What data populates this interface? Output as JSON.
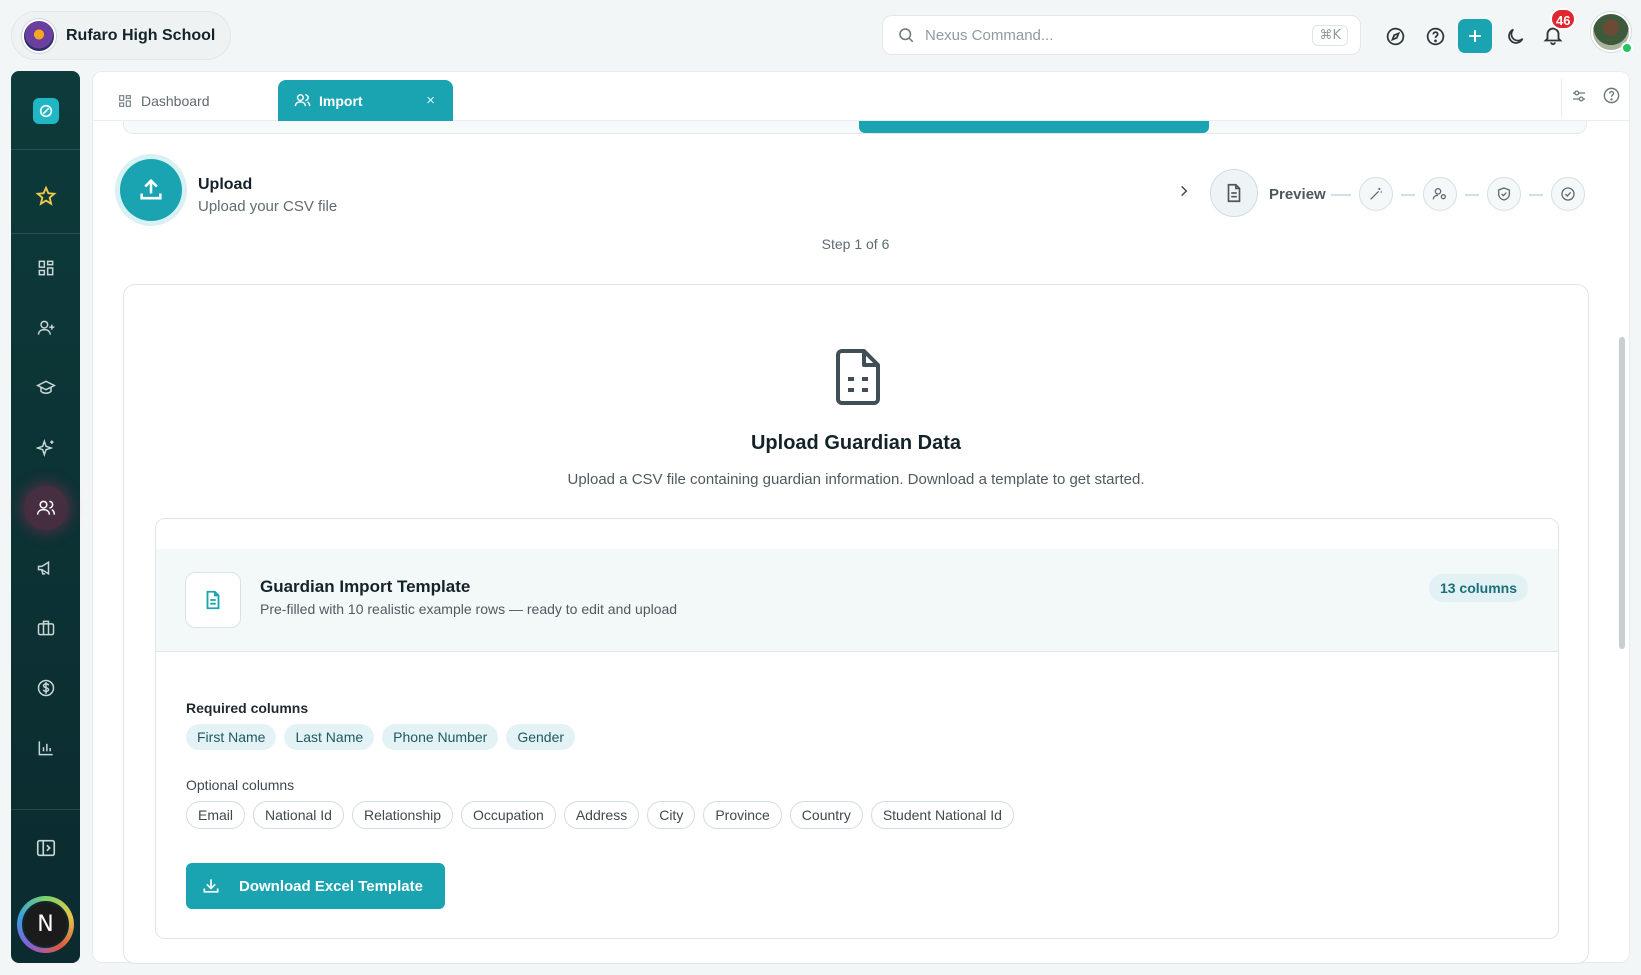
{
  "header": {
    "school_name": "Rufaro High School",
    "search_placeholder": "Nexus Command...",
    "search_shortcut": "⌘K",
    "notification_count": "46",
    "icons": [
      "compass-icon",
      "help-icon",
      "plus-icon",
      "moon-icon",
      "bell-icon"
    ]
  },
  "sidebar": {
    "items": [
      "favorites",
      "dashboard",
      "add-user",
      "academics",
      "ai-sparkles",
      "people",
      "announcements",
      "briefcase",
      "finance",
      "reports"
    ],
    "active": "people",
    "user_initial": "N"
  },
  "tabs": [
    {
      "label": "Dashboard",
      "active": false
    },
    {
      "label": "Import",
      "active": true,
      "close": "×"
    }
  ],
  "stepper": {
    "current_title": "Upload",
    "current_subtitle": "Upload your CSV file",
    "next_label": "Preview",
    "step_count": "Step 1 of 6"
  },
  "upload": {
    "title": "Upload Guardian Data",
    "description": "Upload a CSV file containing guardian information. Download a template to get started."
  },
  "template": {
    "title": "Guardian Import Template",
    "subtitle": "Pre-filled with 10 realistic example rows — ready to edit and upload",
    "columns_badge": "13 columns",
    "required_label": "Required columns",
    "required": [
      "First Name",
      "Last Name",
      "Phone Number",
      "Gender"
    ],
    "optional_label": "Optional columns",
    "optional": [
      "Email",
      "National Id",
      "Relationship",
      "Occupation",
      "Address",
      "City",
      "Province",
      "Country",
      "Student National Id"
    ],
    "download_label": "Download Excel Template"
  },
  "colors": {
    "accent": "#1aa3b1",
    "sidebar": "#0d3a3a",
    "badge": "#e0262e"
  }
}
